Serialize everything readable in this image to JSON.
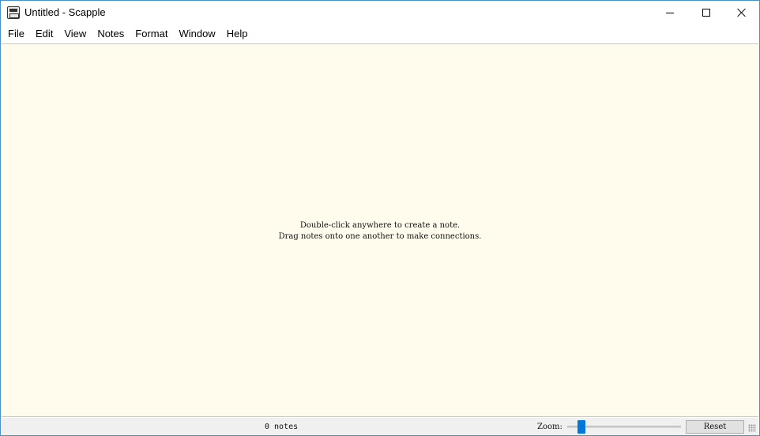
{
  "window": {
    "title": "Untitled - Scapple",
    "controls": {
      "minimize": "minimize-icon",
      "maximize": "maximize-icon",
      "close": "close-icon"
    }
  },
  "menu": [
    {
      "label": "File"
    },
    {
      "label": "Edit"
    },
    {
      "label": "View"
    },
    {
      "label": "Notes"
    },
    {
      "label": "Format"
    },
    {
      "label": "Window"
    },
    {
      "label": "Help"
    }
  ],
  "canvas": {
    "hint_line_1": "Double-click anywhere to create a note.",
    "hint_line_2": "Drag notes onto one another to make connections.",
    "background_color": "#fffcee"
  },
  "statusbar": {
    "notes_count": "0 notes",
    "zoom_label": "Zoom:",
    "reset_label": "Reset",
    "slider_color": "#0078d7"
  }
}
